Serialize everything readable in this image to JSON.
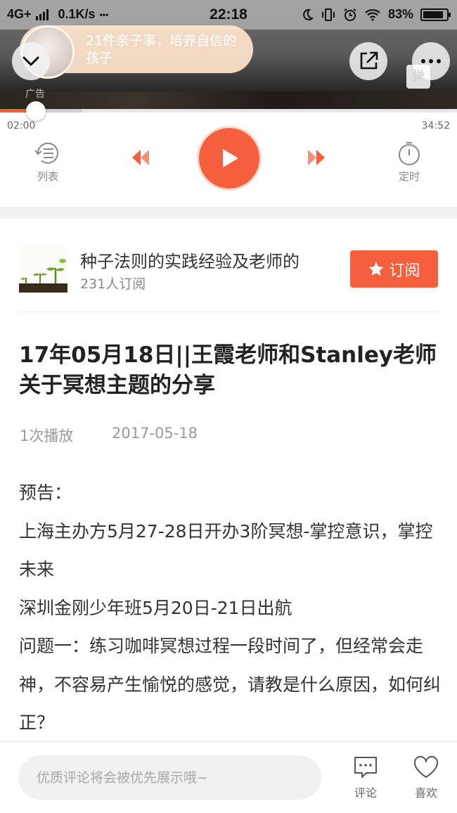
{
  "status_bar": {
    "network": "4G+",
    "speed": "0.1K/s",
    "dots": "•••",
    "time": "22:18",
    "battery": "83%"
  },
  "header": {
    "ad_text": "21件亲子事，培养自信的孩子",
    "ad_label": "广告",
    "danmaku_label": "弹"
  },
  "player": {
    "current_time": "02:00",
    "total_time": "34:52",
    "progress_fraction": 0.057,
    "buffer_fraction": 0.18,
    "list_label": "列表",
    "timer_label": "定时"
  },
  "album": {
    "title": "种子法则的实践经验及老师的",
    "subscribers": "231人订阅",
    "subscribe_label": "订阅"
  },
  "track": {
    "title": "17年05月18日||王霞老师和Stanley老师关于冥想主题的分享",
    "plays": "1次播放",
    "date": "2017-05-18"
  },
  "content": {
    "lines": [
      "预告：",
      "上海主办方5月27-28日开办3阶冥想-掌控意识，掌控未来",
      "深圳金刚少年班5月20日-21日出航",
      "问题一：练习咖啡冥想过程一段时间了，但经常会走神，不容易产生愉悦的感觉，请教是什么原因，如何纠正？"
    ]
  },
  "bottom_bar": {
    "comment_placeholder": "优质评论将会被优先展示哦~",
    "comment_label": "评论",
    "like_label": "喜欢"
  },
  "colors": {
    "accent": "#f4603d",
    "text": "#333333",
    "muted": "#999999"
  },
  "icons": [
    "chevron-down-icon",
    "share-icon",
    "more-icon",
    "list-icon",
    "prev-icon",
    "play-icon",
    "next-icon",
    "timer-icon",
    "star-icon",
    "comment-icon",
    "heart-icon"
  ]
}
